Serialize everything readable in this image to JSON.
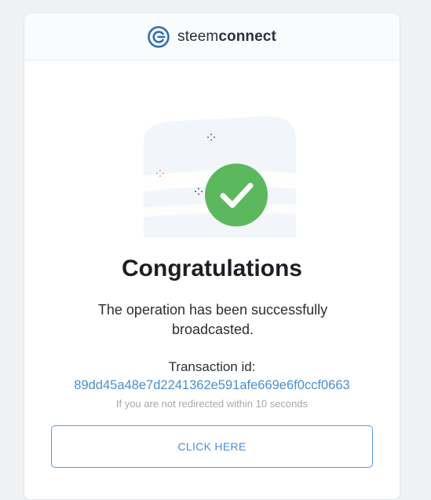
{
  "brand": {
    "name_light": "steem",
    "name_bold": "connect",
    "logo_icon": "steemconnect-logo-icon",
    "color": "#2e6fae"
  },
  "status": {
    "icon": "check-circle-icon",
    "color": "#5cb85c",
    "title": "Congratulations",
    "message": "The operation has been successfully broadcasted."
  },
  "transaction": {
    "label": "Transaction id:",
    "id": "89dd45a48e7d2241362e591afe669e6f0ccf0663",
    "link_color": "#4a8fd0"
  },
  "redirect": {
    "note": "If you are not redirected within 10 seconds",
    "button_label": "CLICK HERE"
  }
}
